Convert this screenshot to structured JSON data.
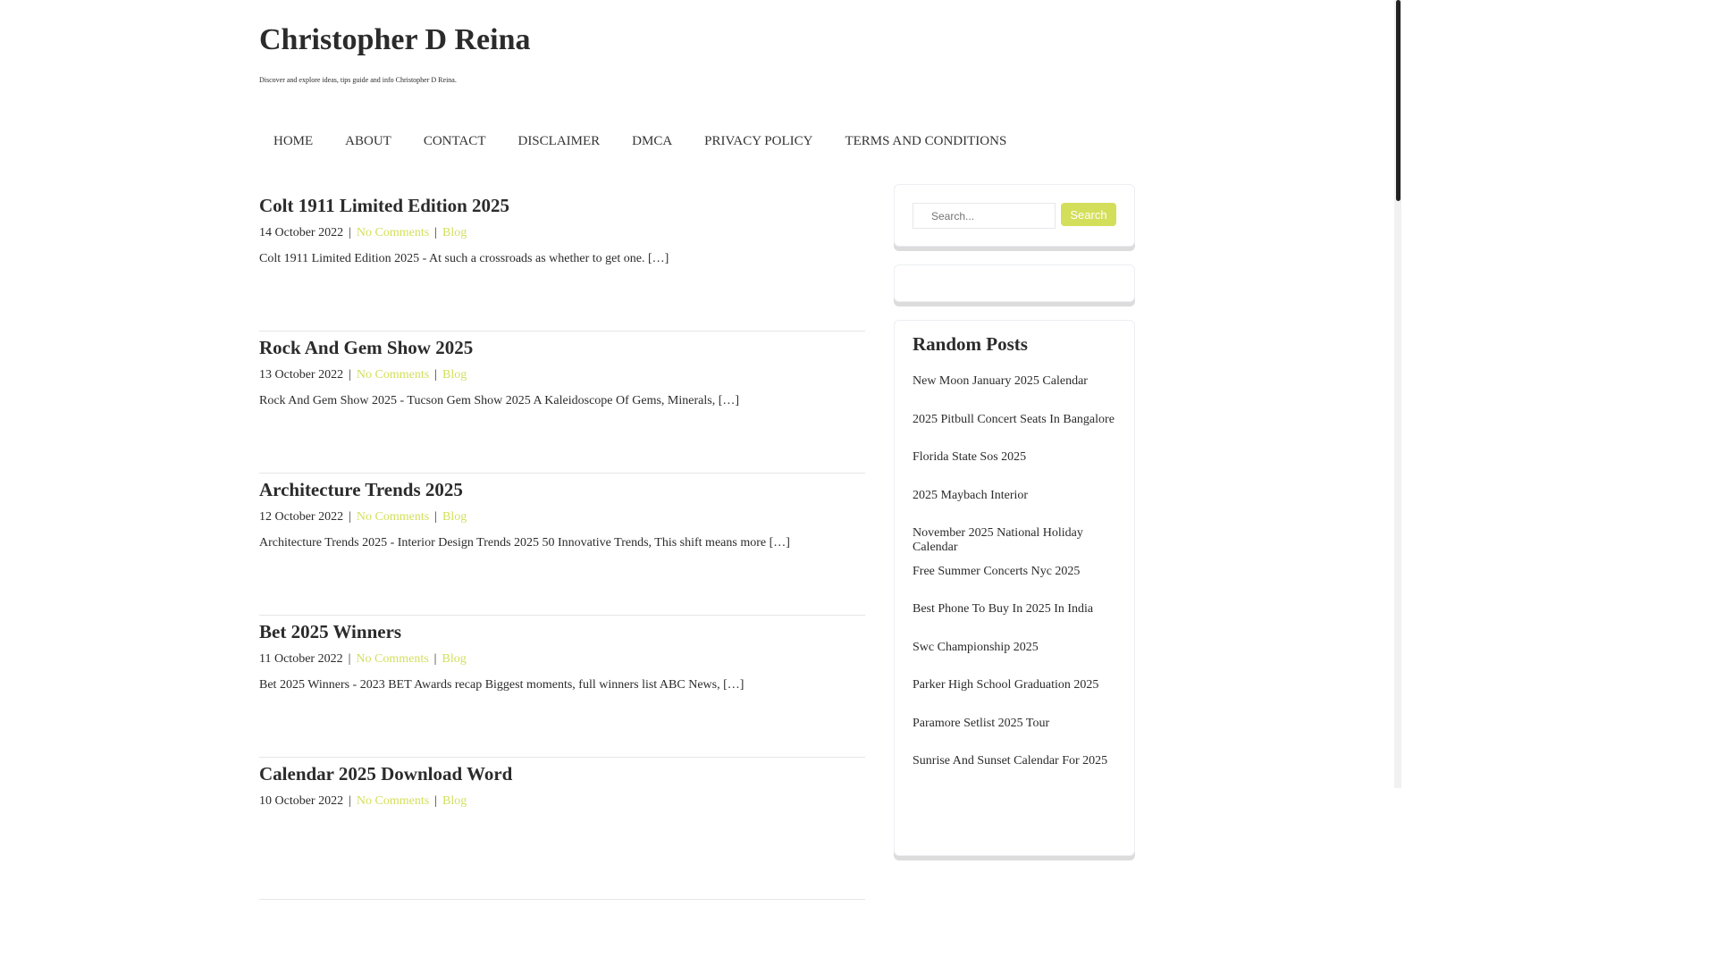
{
  "site": {
    "title": "Christopher D Reina",
    "tagline": "Discover and explore ideas, tips guide and info Christopher D Reina."
  },
  "nav": [
    "HOME",
    "ABOUT",
    "CONTACT",
    "DISCLAIMER",
    "DMCA",
    "PRIVACY POLICY",
    "TERMS AND CONDITIONS"
  ],
  "posts": [
    {
      "title": "Colt 1911 Limited Edition 2025",
      "date": "14 October 2022",
      "comments": "No Comments",
      "category": "Blog",
      "excerpt": "Colt 1911 Limited Edition 2025 - At such a crossroads as whether to get one. […]"
    },
    {
      "title": "Rock And Gem Show 2025",
      "date": "13 October 2022",
      "comments": "No Comments",
      "category": "Blog",
      "excerpt": "Rock And Gem Show 2025 - Tucson Gem Show 2025 A Kaleidoscope Of Gems, Minerals, […]"
    },
    {
      "title": "Architecture Trends 2025",
      "date": "12 October 2022",
      "comments": "No Comments",
      "category": "Blog",
      "excerpt": "Architecture Trends 2025 - Interior Design Trends 2025 50 Innovative Trends, This shift means more […]"
    },
    {
      "title": "Bet 2025 Winners",
      "date": "11 October 2022",
      "comments": "No Comments",
      "category": "Blog",
      "excerpt": "Bet 2025 Winners - 2023 BET Awards recap Biggest moments, full winners list ABC News, […]"
    },
    {
      "title": "Calendar 2025 Download Word",
      "date": "10 October 2022",
      "comments": "No Comments",
      "category": "Blog",
      "excerpt": ""
    }
  ],
  "meta_sep": "|",
  "search": {
    "placeholder": "Search...",
    "button": "Search"
  },
  "random": {
    "title": "Random Posts",
    "items": [
      "New Moon January 2025 Calendar",
      "2025 Pitbull Concert Seats In Bangalore",
      "Florida State Sos 2025",
      "2025 Maybach Interior",
      "November 2025 National Holiday Calendar",
      "Free Summer Concerts Nyc 2025",
      "Best Phone To Buy In 2025 In India",
      "Swc Championship 2025",
      "Parker High School Graduation 2025",
      "Paramore Setlist 2025 Tour",
      "Sunrise And Sunset Calendar For 2025"
    ]
  },
  "colors": {
    "accent": "#d3df5a"
  }
}
